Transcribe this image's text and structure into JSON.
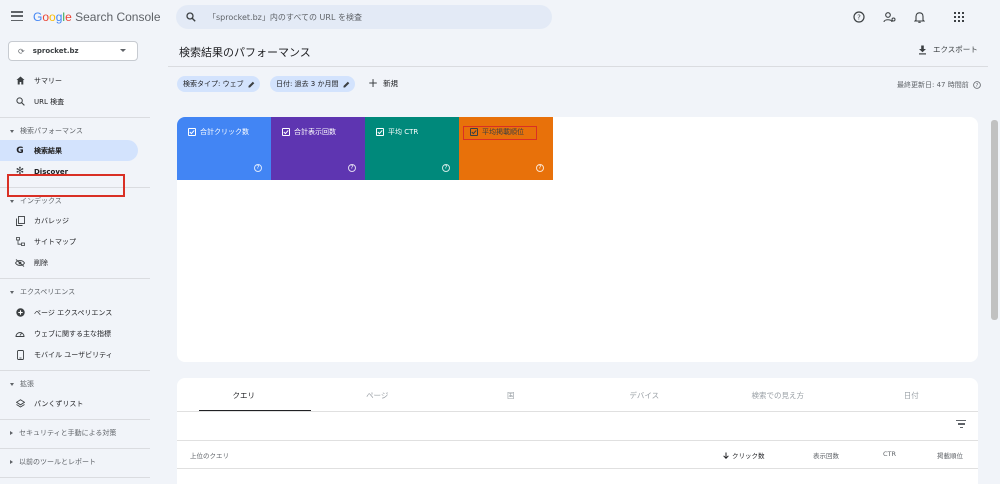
{
  "app": {
    "logo_google": "Google",
    "logo_product": "Search Console",
    "search_placeholder": "「sprocket.bz」内のすべての URL を検査",
    "icons": [
      "menu-icon",
      "search-icon",
      "help-icon",
      "account-settings-icon",
      "bell-icon",
      "apps-grid-icon"
    ]
  },
  "sidebar": {
    "property": "sprocket.bz",
    "items": {
      "summary": "サマリー",
      "url_inspect": "URL 検査",
      "search_results": "検索結果",
      "discover": "Discover",
      "coverage": "カバレッジ",
      "sitemaps": "サイトマップ",
      "removals": "削除",
      "page_experience": "ページ エクスペリエンス",
      "web_vitals": "ウェブに関する主な指標",
      "mobile_usability": "モバイル ユーザビリティ",
      "breadcrumbs": "パンくずリスト"
    },
    "sections": {
      "search_performance": "検索パフォーマンス",
      "index": "インデックス",
      "experience": "エクスペリエンス",
      "enhancements": "拡張",
      "security": "セキュリティと手動による対策",
      "legacy": "以前のツールとレポート"
    }
  },
  "main": {
    "title": "検索結果のパフォーマンス",
    "export_label": "エクスポート",
    "filters": [
      {
        "label": "検索タイプ: ウェブ"
      },
      {
        "label": "日付: 過去 3 か月間"
      }
    ],
    "add_new": "新規",
    "last_updated": "最終更新日: 47 時間前",
    "metrics": [
      {
        "label": "合計クリック数",
        "color": "#4285f4",
        "checked": true
      },
      {
        "label": "合計表示回数",
        "color": "#5e35b1",
        "checked": true
      },
      {
        "label": "平均 CTR",
        "color": "#00897b",
        "checked": true
      },
      {
        "label": "平均掲載順位",
        "color": "#e8710a",
        "checked": true
      }
    ],
    "tabs": [
      "クエリ",
      "ページ",
      "国",
      "デバイス",
      "検索での見え方",
      "日付"
    ],
    "active_tab": "クエリ",
    "table_headers": {
      "query": "上位のクエリ",
      "clicks": "クリック数",
      "impressions": "表示回数",
      "ctr": "CTR",
      "position": "掲載順位"
    }
  }
}
